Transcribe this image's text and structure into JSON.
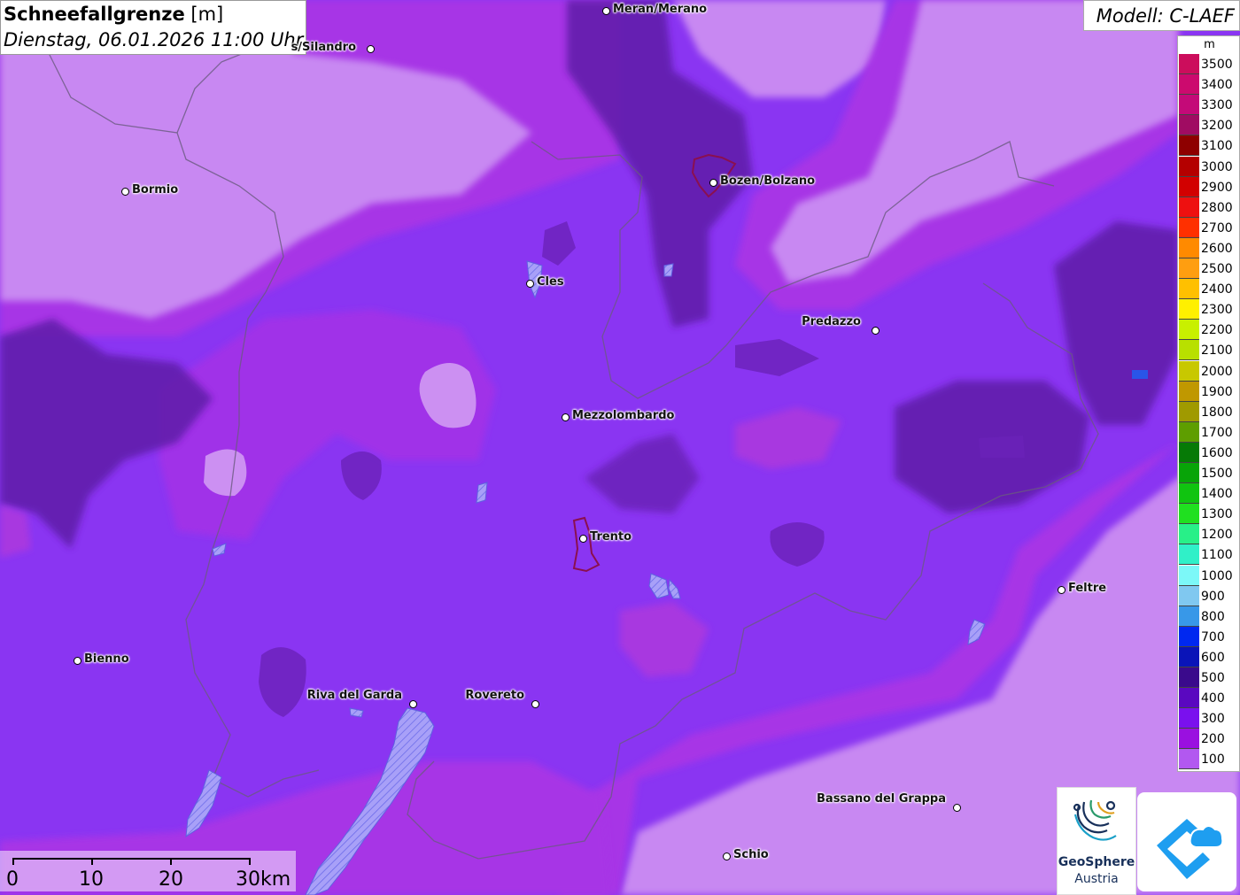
{
  "title": {
    "main": "Schneefallgrenze",
    "unit": "[m]",
    "datetime": "Dienstag, 06.01.2026 11:00 Uhr"
  },
  "model": "Modell: C-LAEF",
  "legend": {
    "unit": "m",
    "entries": [
      {
        "label": "3500",
        "color": "#cc0d5c"
      },
      {
        "label": "3400",
        "color": "#cc0a6e"
      },
      {
        "label": "3300",
        "color": "#c40a78"
      },
      {
        "label": "3200",
        "color": "#a00c62"
      },
      {
        "label": "3100",
        "color": "#8e0000"
      },
      {
        "label": "3000",
        "color": "#b40000"
      },
      {
        "label": "2900",
        "color": "#d20000"
      },
      {
        "label": "2800",
        "color": "#ee1010"
      },
      {
        "label": "2700",
        "color": "#ff3000"
      },
      {
        "label": "2600",
        "color": "#ff8a00"
      },
      {
        "label": "2500",
        "color": "#ff9e10"
      },
      {
        "label": "2400",
        "color": "#ffc000"
      },
      {
        "label": "2300",
        "color": "#fff000"
      },
      {
        "label": "2200",
        "color": "#c8f000"
      },
      {
        "label": "2100",
        "color": "#b8e000"
      },
      {
        "label": "2000",
        "color": "#c8c800"
      },
      {
        "label": "1900",
        "color": "#c09800"
      },
      {
        "label": "1800",
        "color": "#a09a00"
      },
      {
        "label": "1700",
        "color": "#5e9e00"
      },
      {
        "label": "1600",
        "color": "#067a06"
      },
      {
        "label": "1500",
        "color": "#08a408"
      },
      {
        "label": "1400",
        "color": "#10c410"
      },
      {
        "label": "1300",
        "color": "#20e020"
      },
      {
        "label": "1200",
        "color": "#28f088"
      },
      {
        "label": "1100",
        "color": "#30f0c8"
      },
      {
        "label": "1000",
        "color": "#7cf8f8"
      },
      {
        "label": "900",
        "color": "#80c8f0"
      },
      {
        "label": "800",
        "color": "#3898e8"
      },
      {
        "label": "700",
        "color": "#0028f0"
      },
      {
        "label": "600",
        "color": "#0a14b8"
      },
      {
        "label": "500",
        "color": "#3a0a8c"
      },
      {
        "label": "400",
        "color": "#5a08c0"
      },
      {
        "label": "300",
        "color": "#7a10ee"
      },
      {
        "label": "200",
        "color": "#9a10e0"
      },
      {
        "label": "100",
        "color": "#b258f0"
      }
    ]
  },
  "places": [
    {
      "id": "meran",
      "label": "Meran/Merano"
    },
    {
      "id": "silandro",
      "label": "s/Silandro"
    },
    {
      "id": "bormio",
      "label": "Bormio"
    },
    {
      "id": "bozen",
      "label": "Bozen/Bolzano"
    },
    {
      "id": "cles",
      "label": "Cles"
    },
    {
      "id": "predazzo",
      "label": "Predazzo"
    },
    {
      "id": "mezzolombardo",
      "label": "Mezzolombardo"
    },
    {
      "id": "trento",
      "label": "Trento"
    },
    {
      "id": "feltre",
      "label": "Feltre"
    },
    {
      "id": "bienno",
      "label": "Bienno"
    },
    {
      "id": "riva",
      "label": "Riva del Garda"
    },
    {
      "id": "rovereto",
      "label": "Rovereto"
    },
    {
      "id": "bassano",
      "label": "Bassano del Grappa"
    },
    {
      "id": "schio",
      "label": "Schio"
    }
  ],
  "scale": {
    "labels": [
      "0",
      "10",
      "20",
      "30km"
    ]
  },
  "logo": {
    "line1": "GeoSphere",
    "line2": "Austria"
  }
}
